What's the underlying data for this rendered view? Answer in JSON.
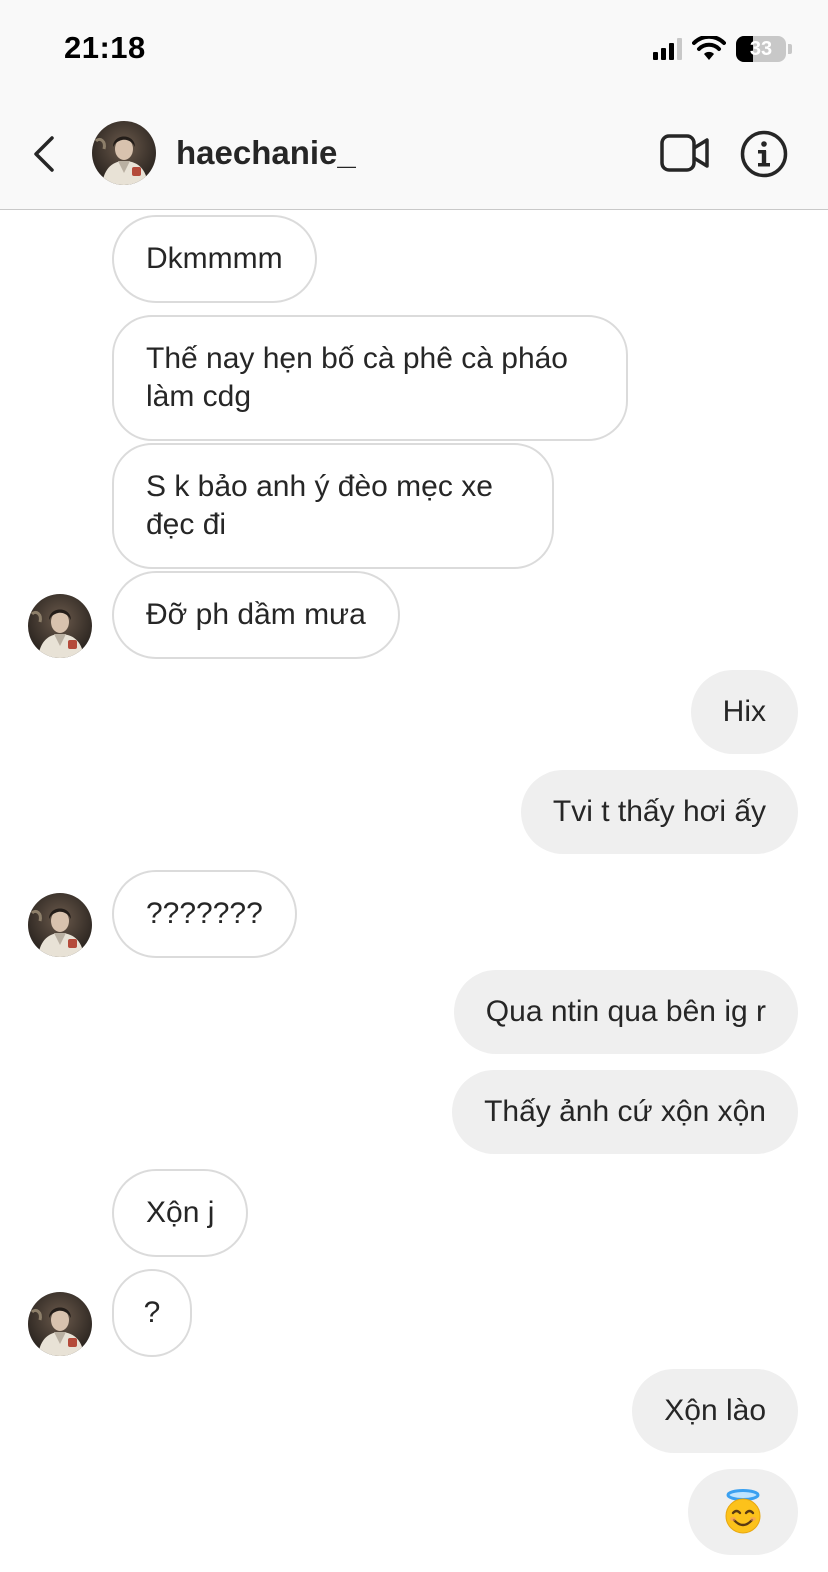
{
  "status_bar": {
    "time": "21:18",
    "battery": "33",
    "battery_fraction": 0.33
  },
  "header": {
    "username": "haechanie_"
  },
  "icons": {
    "back": "chevron-left-icon",
    "video": "video-camera-icon",
    "info": "info-circle-icon",
    "signal": "cellular-signal-icon",
    "wifi": "wifi-icon",
    "battery": "battery-icon"
  },
  "colors": {
    "incoming_border": "#dbdbdb",
    "outgoing_bg": "#efefef",
    "text": "#262626",
    "header_bg": "#f9f9f9"
  },
  "messages": [
    {
      "from": "them",
      "text": "Dkmmmm"
    },
    {
      "from": "them",
      "text": "Thế nay hẹn bố cà phê cà pháo làm cdg"
    },
    {
      "from": "them",
      "text": "S k bảo anh ý đèo mẹc xe đẹc đi"
    },
    {
      "from": "them",
      "text": "Đỡ ph dầm mưa",
      "avatar": true
    },
    {
      "from": "me",
      "text": "Hix"
    },
    {
      "from": "me",
      "text": "Tvi t thấy hơi ấy"
    },
    {
      "from": "them",
      "text": "???????",
      "avatar": true
    },
    {
      "from": "me",
      "text": "Qua ntin qua bên ig r"
    },
    {
      "from": "me",
      "text": "Thấy ảnh cứ xộn xộn"
    },
    {
      "from": "them",
      "text": "Xộn j"
    },
    {
      "from": "them",
      "text": "?",
      "avatar": true
    },
    {
      "from": "me",
      "text": "Xộn lào"
    },
    {
      "from": "me",
      "emoji": "smiling-face-with-halo-icon"
    }
  ]
}
